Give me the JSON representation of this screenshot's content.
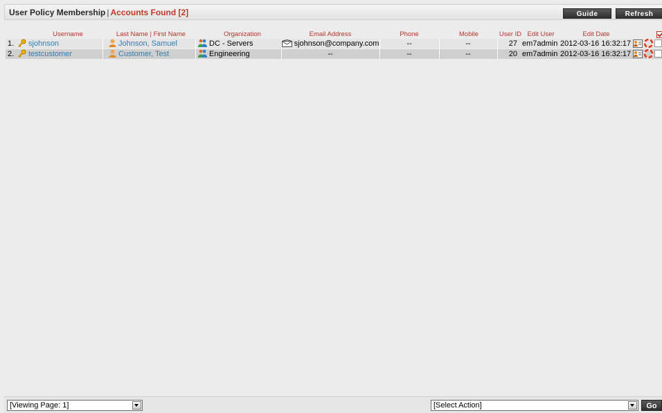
{
  "header": {
    "title": "User Policy Membership",
    "separator": "|",
    "count_text": "Accounts Found [2]",
    "guide_label": "Guide",
    "refresh_label": "Refresh"
  },
  "table": {
    "columns": {
      "username": "Username",
      "name": "Last Name | First Name",
      "organization": "Organization",
      "email": "Email Address",
      "phone": "Phone",
      "mobile": "Mobile",
      "user_id": "User ID",
      "edit_user": "Edit User",
      "edit_date": "Edit Date"
    },
    "rows": [
      {
        "index": "1.",
        "username": "sjohnson",
        "name": "Johnson, Samuel",
        "organization": "DC - Servers",
        "email": "sjohnson@company.com",
        "phone": "--",
        "mobile": "--",
        "user_id": "27",
        "edit_user": "em7admin",
        "edit_date": "2012-03-16 16:32:17"
      },
      {
        "index": "2.",
        "username": "testcustomer",
        "name": "Customer, Test",
        "organization": "Engineering",
        "email": "--",
        "phone": "--",
        "mobile": "--",
        "user_id": "20",
        "edit_user": "em7admin",
        "edit_date": "2012-03-16 16:32:17"
      }
    ]
  },
  "footer": {
    "viewing_page": "[Viewing Page: 1]",
    "select_action": "[Select Action]",
    "go_label": "Go"
  },
  "colors": {
    "accent_red": "#c0392b",
    "link_blue": "#2f7eb2",
    "button_dark": "#3a3a3a"
  }
}
